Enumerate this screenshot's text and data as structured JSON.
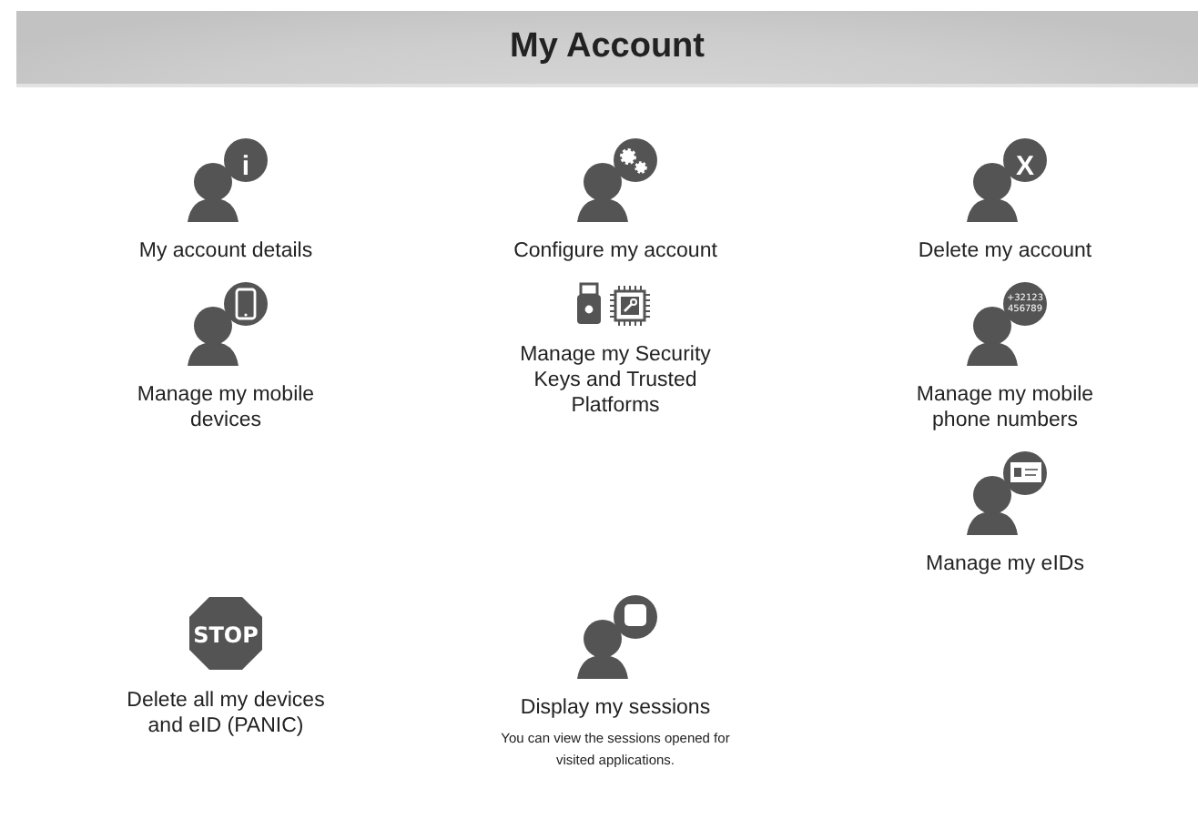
{
  "header": {
    "title": "My Account"
  },
  "rows": [
    [
      {
        "kind": "info",
        "label": "My account details",
        "badge": "i"
      },
      {
        "kind": "gears",
        "label": "Configure my account"
      },
      {
        "kind": "delete",
        "label": "Delete my account",
        "badge": "X"
      }
    ],
    [
      {
        "kind": "mobile",
        "label": "Manage my mobile devices"
      },
      {
        "kind": "keys",
        "label": "Manage my Security Keys and Trusted Platforms"
      },
      {
        "kind": "phone",
        "label": "Manage my mobile phone numbers",
        "badge_lines": [
          "+32123",
          "456789"
        ]
      }
    ],
    [
      null,
      null,
      {
        "kind": "eid",
        "label": "Manage my eIDs"
      }
    ],
    [
      {
        "kind": "stop",
        "label": "Delete all my devices and eID (PANIC)",
        "badge": "STOP"
      },
      {
        "kind": "sessions",
        "label": "Display my sessions",
        "description": "You can view the sessions opened for visited applications."
      },
      null
    ]
  ]
}
